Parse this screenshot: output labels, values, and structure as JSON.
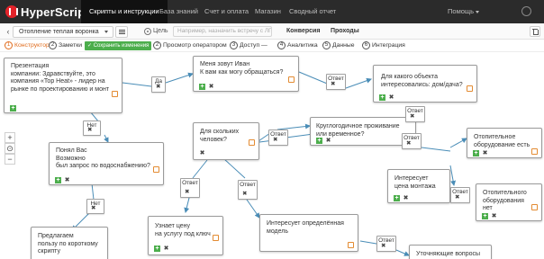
{
  "app": {
    "logo": "HyperScript",
    "nav": [
      "Скрипты и инструкции",
      "База знаний",
      "Счет и оплата",
      "Магазин",
      "Сводный отчет"
    ],
    "help": "Помощь"
  },
  "toolbar": {
    "back_icon": "‹",
    "funnel": "Отопление теплая воронка",
    "goal_label": "Цель",
    "goal_placeholder": "Например, назначить встречу с ЛПР",
    "tabs": [
      "Конверсия",
      "Проходы"
    ]
  },
  "steps": {
    "items": [
      {
        "num": "1",
        "label": "Конструктор"
      },
      {
        "num": "2",
        "label": "Заметки"
      },
      {
        "num": "2",
        "label": "Просмотр оператором"
      },
      {
        "num": "3",
        "label": "Доступ"
      },
      {
        "num": "4",
        "label": "Аналитика"
      },
      {
        "num": "5",
        "label": "Данные"
      },
      {
        "num": "6",
        "label": "Интеграция"
      }
    ],
    "saved_badge": "✓ Сохранить изменения",
    "access_dash": "—"
  },
  "zoom": {
    "plus": "+",
    "reset": "⊙",
    "minus": "−"
  },
  "colors": {
    "brand": "#e3232a",
    "accent": "#e06a1a",
    "plus_green": "#4cae4c",
    "link": "#4a8db7"
  },
  "nodes": {
    "n1": "Презентация\nкомпании: Здравствуйте, это\nкомпания «Top Heat» - лидер на\nрынке по проектированию и монт",
    "n2": "Меня зовут Иван\nК вам как могу обращаться?",
    "n3": "Для какого объекта\nинтересовались: дом/дача?",
    "n4": "Понял Вас\nВозможно\nбыл запрос по водоснабжению?",
    "n5": "Для скольких\nчеловек?",
    "n6": "Круглогодичное проживание\nили временное?",
    "n7": "Отопительное\nоборудование есть",
    "n8": "Интересует\nцена монтажа",
    "n9": "Отопительного\nоборудования\nнет",
    "n10": "Узнает цену\nна услугу под ключ",
    "n11": "Интересует определённая\nмодель",
    "n12": "Предлагаем\nпользу по короткому\nскрипту",
    "n13": "Уточняющие вопросы"
  },
  "tags": {
    "t1": "Да",
    "t2": "Нет",
    "t3": "Ответ",
    "t4": "Нет",
    "t5": "Ответ",
    "t6": "Ответ",
    "t7": "Ответ",
    "t8": "Ответ",
    "t9": "Ответ",
    "t10": "Ответ",
    "t11": "Ответ"
  }
}
